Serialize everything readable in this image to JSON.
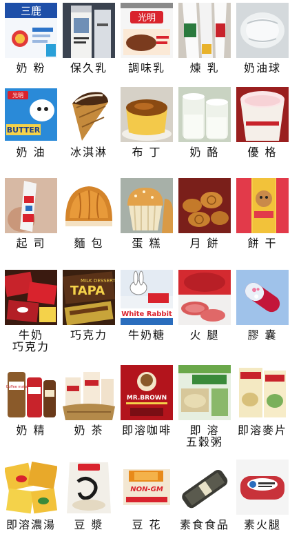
{
  "items": [
    {
      "label": "奶 粉",
      "icon": "milk-powder-can"
    },
    {
      "label": "保久乳",
      "icon": "uht-milk-carton"
    },
    {
      "label": "調味乳",
      "icon": "flavored-milk-carton"
    },
    {
      "label": "煉 乳",
      "icon": "condensed-milk-tube"
    },
    {
      "label": "奶油球",
      "icon": "creamer-cup"
    },
    {
      "label": "奶 油",
      "icon": "butter-pack"
    },
    {
      "label": "冰淇淋",
      "icon": "ice-cream-cone"
    },
    {
      "label": "布 丁",
      "icon": "pudding"
    },
    {
      "label": "奶 酪",
      "icon": "yogurt-jars"
    },
    {
      "label": "優 格",
      "icon": "yogurt-cup"
    },
    {
      "label": "起 司",
      "icon": "cheese-stick"
    },
    {
      "label": "麵 包",
      "icon": "bread-loaf"
    },
    {
      "label": "蛋 糕",
      "icon": "muffin"
    },
    {
      "label": "月 餅",
      "icon": "mooncakes"
    },
    {
      "label": "餅 干",
      "icon": "biscuit-boxes"
    },
    {
      "label": "牛奶\n巧克力",
      "icon": "chocolate-bars"
    },
    {
      "label": "巧克力",
      "icon": "tapa-chocolate"
    },
    {
      "label": "牛奶糖",
      "icon": "white-rabbit-candy"
    },
    {
      "label": "火 腿",
      "icon": "ham-slices"
    },
    {
      "label": "膠 囊",
      "icon": "capsule"
    },
    {
      "label": "奶 精",
      "icon": "coffee-mate-jars"
    },
    {
      "label": "奶 茶",
      "icon": "milk-tea-basket"
    },
    {
      "label": "即溶咖啡",
      "icon": "mr-brown-coffee"
    },
    {
      "label": "即 溶\n五穀粥",
      "icon": "grain-porridge-box"
    },
    {
      "label": "即溶麥片",
      "icon": "oatmeal-packs"
    },
    {
      "label": "即溶濃湯",
      "icon": "soup-packets"
    },
    {
      "label": "豆 漿",
      "icon": "soy-milk-bag"
    },
    {
      "label": "豆 花",
      "icon": "tofu-pudding-box"
    },
    {
      "label": "素食食品",
      "icon": "vegetarian-food-bag"
    },
    {
      "label": "素火腿",
      "icon": "vegetarian-ham"
    }
  ],
  "text": {
    "brand_sanlu": "三鹿",
    "brand_guangming": "光明",
    "butter": "BUTTER",
    "tapa": "TAPA",
    "milk_dessert": "MILK DESSERT",
    "white_rabbit": "White Rabbit",
    "mr_brown": "MR.BROWN",
    "non_gm": "NON-GM",
    "coffee_mate": "Coffee mate"
  }
}
